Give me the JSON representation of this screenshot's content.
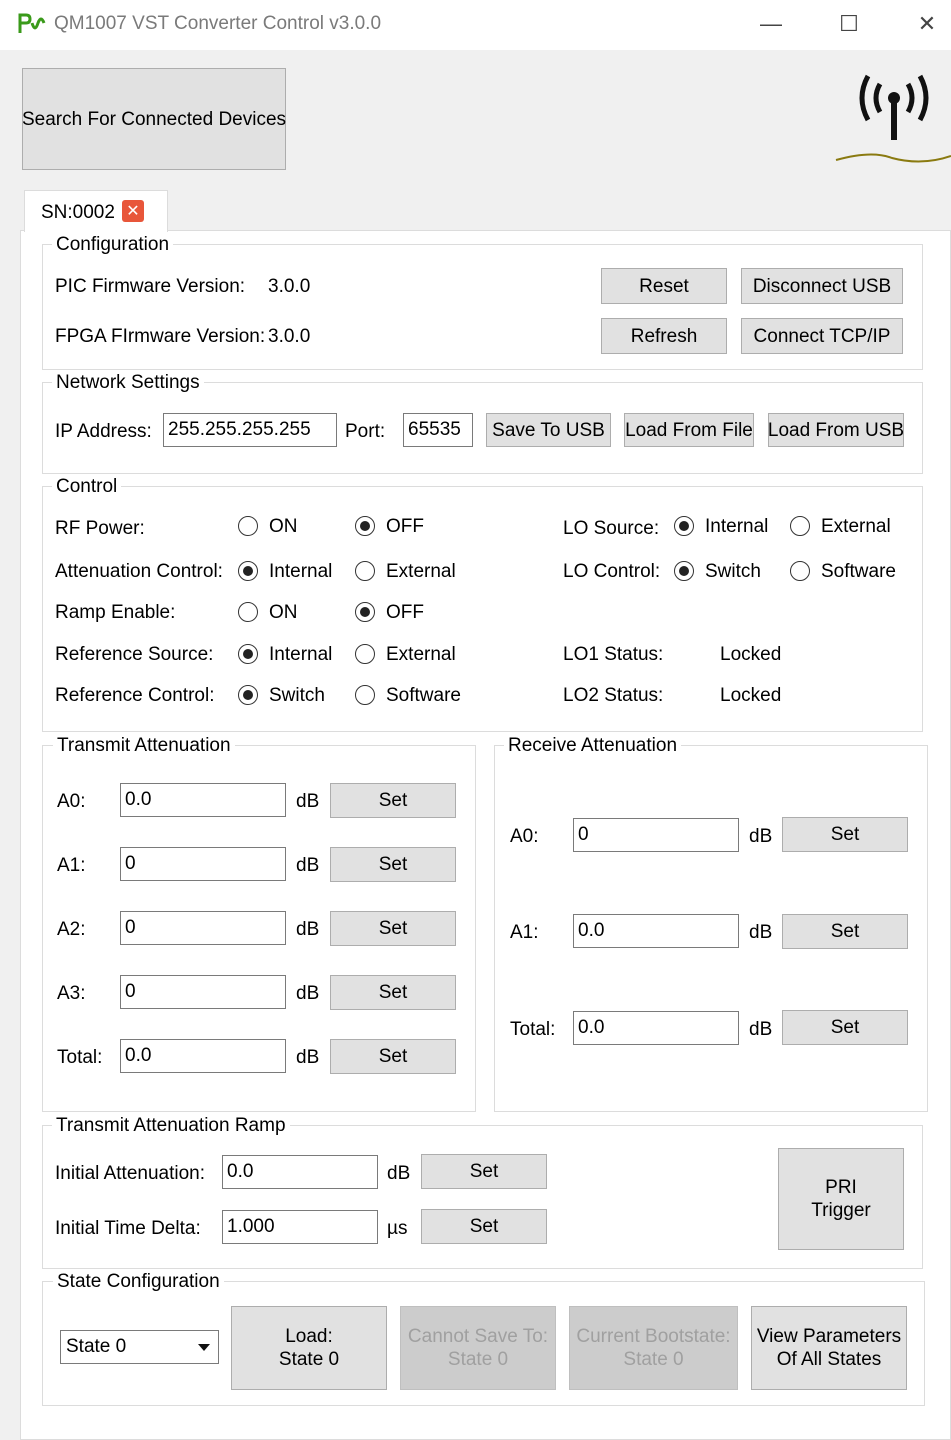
{
  "window": {
    "title": "QM1007 VST Converter Control v3.0.0"
  },
  "header": {
    "search_button": "Search For Connected Devices"
  },
  "tab": {
    "label": "SN:0002"
  },
  "configuration": {
    "legend": "Configuration",
    "pic_label": "PIC Firmware Version:",
    "pic_value": "3.0.0",
    "fpga_label": "FPGA FIrmware Version:",
    "fpga_value": "3.0.0",
    "reset": "Reset",
    "disconnect_usb": "Disconnect USB",
    "refresh": "Refresh",
    "connect_tcp": "Connect TCP/IP"
  },
  "network": {
    "legend": "Network Settings",
    "ip_label": "IP Address:",
    "ip_value": "255.255.255.255",
    "port_label": "Port:",
    "port_value": "65535",
    "save_usb": "Save To USB",
    "load_file": "Load From File",
    "load_usb": "Load From USB"
  },
  "control": {
    "legend": "Control",
    "rf_power": "RF Power:",
    "rf_on": "ON",
    "rf_off": "OFF",
    "att_control": "Attenuation Control:",
    "att_internal": "Internal",
    "att_external": "External",
    "ramp_enable": "Ramp Enable:",
    "ramp_on": "ON",
    "ramp_off": "OFF",
    "ref_source": "Reference Source:",
    "ref_internal": "Internal",
    "ref_external": "External",
    "ref_control": "Reference Control:",
    "ref_switch": "Switch",
    "ref_software": "Software",
    "lo_source": "LO Source:",
    "lo_internal": "Internal",
    "lo_external": "External",
    "lo_control": "LO Control:",
    "lo_switch": "Switch",
    "lo_software": "Software",
    "lo1_status_label": "LO1 Status:",
    "lo1_status": "Locked",
    "lo2_status_label": "LO2 Status:",
    "lo2_status": "Locked"
  },
  "transmit": {
    "legend": "Transmit Attenuation",
    "rows": [
      {
        "label": "A0:",
        "value": "0.0",
        "unit": "dB",
        "button": "Set"
      },
      {
        "label": "A1:",
        "value": "0",
        "unit": "dB",
        "button": "Set"
      },
      {
        "label": "A2:",
        "value": "0",
        "unit": "dB",
        "button": "Set"
      },
      {
        "label": "A3:",
        "value": "0",
        "unit": "dB",
        "button": "Set"
      },
      {
        "label": "Total:",
        "value": "0.0",
        "unit": "dB",
        "button": "Set"
      }
    ]
  },
  "receive": {
    "legend": "Receive Attenuation",
    "rows": [
      {
        "label": "A0:",
        "value": "0",
        "unit": "dB",
        "button": "Set"
      },
      {
        "label": "A1:",
        "value": "0.0",
        "unit": "dB",
        "button": "Set"
      },
      {
        "label": "Total:",
        "value": "0.0",
        "unit": "dB",
        "button": "Set"
      }
    ]
  },
  "ramp": {
    "legend": "Transmit Attenuation Ramp",
    "initial_att_label": "Initial Attenuation:",
    "initial_att_value": "0.0",
    "initial_att_unit": "dB",
    "initial_time_label": "Initial Time Delta:",
    "initial_time_value": "1.000",
    "initial_time_unit": "µs",
    "set": "Set",
    "pri_line1": "PRI",
    "pri_line2": "Trigger"
  },
  "state": {
    "legend": "State Configuration",
    "selected": "State 0",
    "load_line1": "Load:",
    "load_line2": "State 0",
    "save_line1": "Cannot Save To:",
    "save_line2": "State 0",
    "boot_line1": "Current Bootstate:",
    "boot_line2": "State 0",
    "view_line1": "View Parameters",
    "view_line2": "Of All States"
  },
  "colors": {
    "accent_green": "#3a9a1a",
    "close_red": "#e8563a",
    "logo_gold": "#8a7a10"
  }
}
